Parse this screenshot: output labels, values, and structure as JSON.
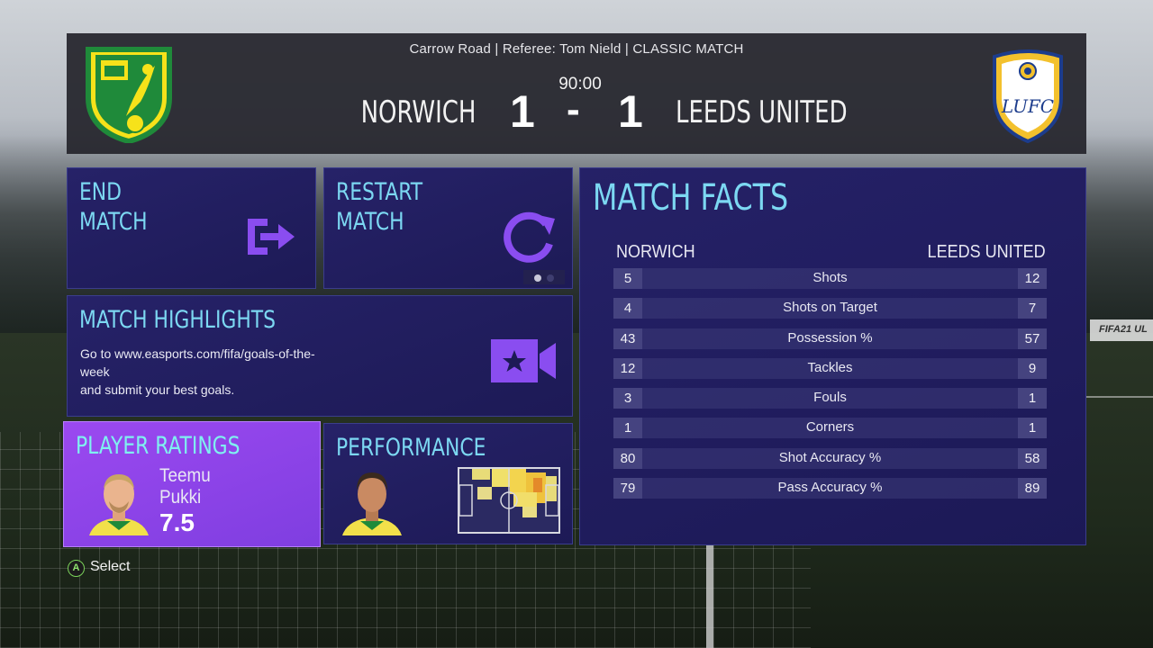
{
  "header": {
    "info": "Carrow Road | Referee: Tom Nield | CLASSIC MATCH",
    "time": "90:00",
    "home_team": "NORWICH",
    "away_team": "LEEDS UNITED",
    "home_score": "1",
    "separator": "-",
    "away_score": "1",
    "home_crest_icon": "norwich-canary-crest-icon",
    "away_crest_icon": "leeds-rose-crest-icon",
    "away_crest_text": "LUFC"
  },
  "tiles": {
    "end_match": {
      "line1": "END",
      "line2": "MATCH",
      "icon": "exit-arrow-icon"
    },
    "restart_match": {
      "line1": "RESTART",
      "line2": "MATCH",
      "icon": "restart-icon"
    },
    "highlights": {
      "title": "MATCH HIGHLIGHTS",
      "line1": "Go to www.easports.com/fifa/goals-of-the-",
      "line2": "week",
      "line3": "and submit your best goals.",
      "icon": "video-star-icon"
    },
    "ratings": {
      "title": "PLAYER RATINGS",
      "first_name": "Teemu",
      "last_name": "Pukki",
      "rating": "7.5"
    },
    "performance": {
      "title": "PERFORMANCE"
    }
  },
  "facts": {
    "title": "MATCH FACTS",
    "home_label": "NORWICH",
    "away_label": "LEEDS UNITED",
    "rows": [
      {
        "home": "5",
        "label": "Shots",
        "away": "12"
      },
      {
        "home": "4",
        "label": "Shots on Target",
        "away": "7"
      },
      {
        "home": "43",
        "label": "Possession %",
        "away": "57"
      },
      {
        "home": "12",
        "label": "Tackles",
        "away": "9"
      },
      {
        "home": "3",
        "label": "Fouls",
        "away": "1"
      },
      {
        "home": "1",
        "label": "Corners",
        "away": "1"
      },
      {
        "home": "80",
        "label": "Shot Accuracy %",
        "away": "58"
      },
      {
        "home": "79",
        "label": "Pass Accuracy %",
        "away": "89"
      }
    ]
  },
  "footer": {
    "button": "A",
    "label": "Select"
  },
  "background": {
    "board_text": "FIFA21 UL"
  },
  "colors": {
    "accent": "#7cd8f2",
    "tile": "#262268",
    "ratings": "#9b49f0",
    "icon_purple": "#8a4df0"
  }
}
